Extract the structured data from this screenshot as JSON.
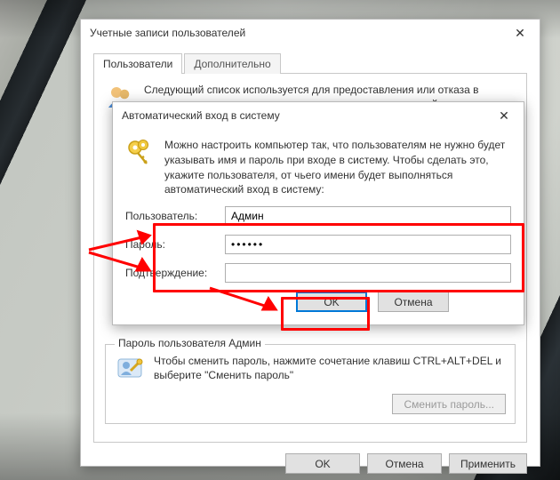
{
  "parent": {
    "title": "Учетные записи пользователей",
    "tabs": {
      "users": "Пользователи",
      "advanced": "Дополнительно"
    },
    "intro": "Следующий список используется для предоставления или отказа в доступе к вашему компьютеру, а также для смены паролей и",
    "group": {
      "legend": "Пароль пользователя Админ",
      "hint": "Чтобы сменить пароль, нажмите сочетание клавиш CTRL+ALT+DEL и выберите \"Сменить пароль\"",
      "change_btn": "Сменить пароль..."
    },
    "buttons": {
      "ok": "OK",
      "cancel": "Отмена",
      "apply": "Применить"
    }
  },
  "child": {
    "title": "Автоматический вход в систему",
    "intro": "Можно настроить компьютер так, что пользователям не нужно будет указывать имя и пароль при входе в систему. Чтобы сделать это, укажите пользователя, от чьего имени будет выполняться автоматический вход в систему:",
    "labels": {
      "user": "Пользователь:",
      "password": "Пароль:",
      "confirm": "Подтверждение:"
    },
    "values": {
      "user": "Админ",
      "password": "••••••",
      "confirm": ""
    },
    "buttons": {
      "ok": "OK",
      "cancel": "Отмена"
    }
  }
}
